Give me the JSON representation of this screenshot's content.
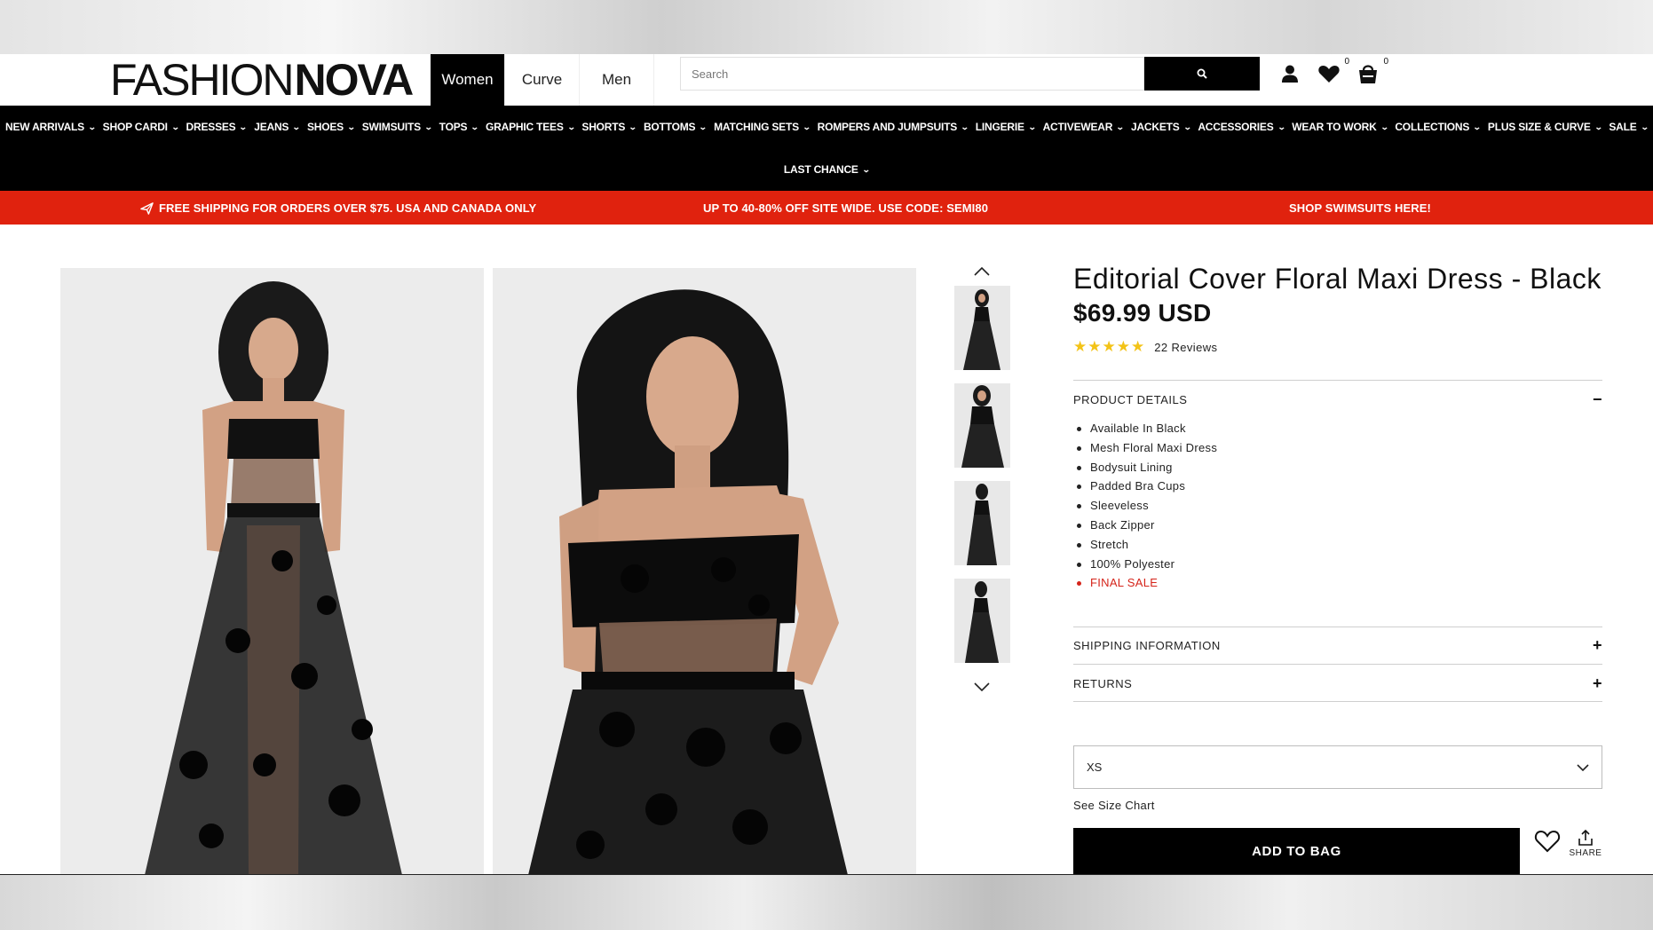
{
  "header": {
    "logo_light": "FASHION",
    "logo_bold": "NOVA",
    "gender_tabs": [
      "Women",
      "Curve",
      "Men"
    ],
    "search_placeholder": "Search",
    "wishlist_count": "0",
    "cart_count": "0"
  },
  "nav": {
    "items": [
      "NEW ARRIVALS",
      "SHOP CARDI",
      "DRESSES",
      "JEANS",
      "SHOES",
      "SWIMSUITS",
      "TOPS",
      "GRAPHIC TEES",
      "SHORTS",
      "BOTTOMS",
      "MATCHING SETS",
      "ROMPERS AND JUMPSUITS",
      "LINGERIE",
      "ACTIVEWEAR",
      "JACKETS",
      "ACCESSORIES",
      "WEAR TO WORK",
      "COLLECTIONS",
      "PLUS SIZE & CURVE",
      "SALE"
    ],
    "last_chance": "LAST CHANCE"
  },
  "promo": {
    "shipping": "FREE SHIPPING FOR ORDERS OVER $75. USA AND CANADA ONLY",
    "discount": "UP TO 40-80% OFF SITE WIDE. USE CODE: SEMI80",
    "swimsuits": "SHOP SWIMSUITS HERE!"
  },
  "product": {
    "title": "Editorial Cover Floral Maxi Dress - Black",
    "price": "$69.99 USD",
    "stars": "★★★★★",
    "rating": 5,
    "reviews": "22 Reviews",
    "details_heading": "PRODUCT DETAILS",
    "details": [
      "Available In Black",
      "Mesh Floral Maxi Dress",
      "Bodysuit Lining",
      "Padded Bra Cups",
      "Sleeveless",
      "Back Zipper",
      "Stretch",
      "100% Polyester"
    ],
    "final_sale": "FINAL SALE",
    "shipping_heading": "SHIPPING INFORMATION",
    "returns_heading": "RETURNS",
    "expand_sign": "+",
    "collapse_sign": "−",
    "selected_size": "XS",
    "size_chart": "See Size Chart",
    "add_to_bag": "ADD TO BAG",
    "share": "SHARE"
  },
  "colors": {
    "promo_red": "#e0220e",
    "star_gold": "#f3c317",
    "final_sale_red": "#d5241a",
    "nav_black": "#000000"
  }
}
